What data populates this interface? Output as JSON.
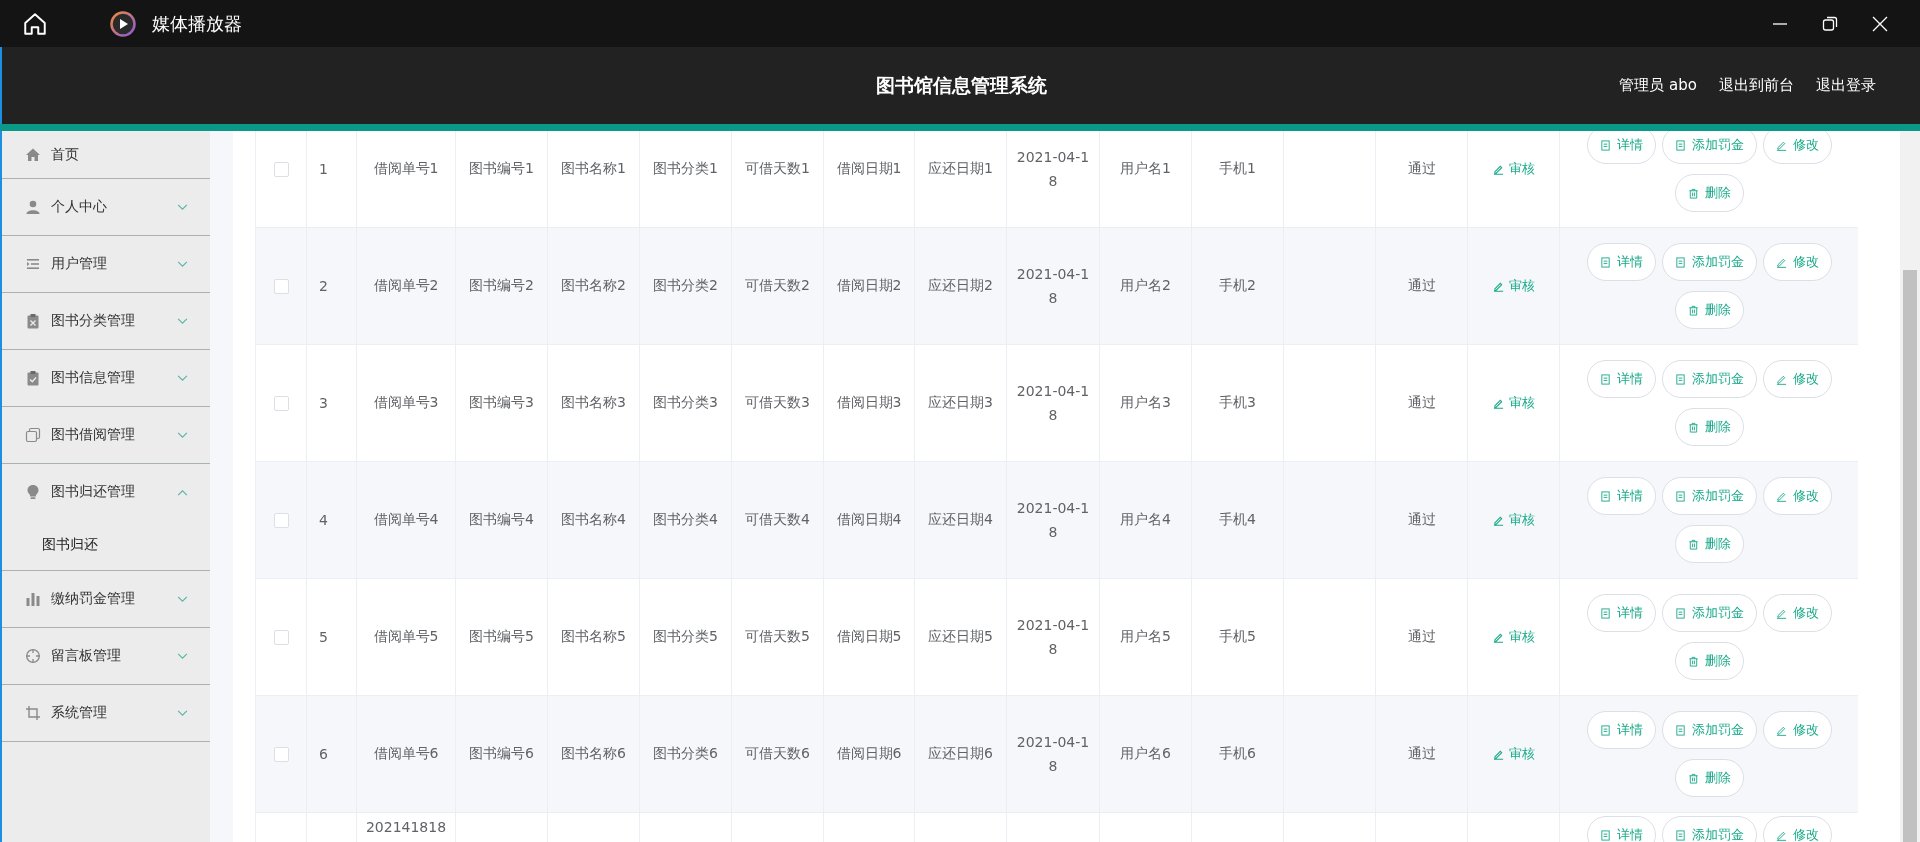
{
  "window": {
    "title": "媒体播放器"
  },
  "header": {
    "title": "图书馆信息管理系统",
    "user": "管理员 abo",
    "links": [
      "退出到前台",
      "退出登录"
    ]
  },
  "sidebar": {
    "items": [
      {
        "label": "首页",
        "kind": "link"
      },
      {
        "label": "个人中心",
        "kind": "menu",
        "expanded": false
      },
      {
        "label": "用户管理",
        "kind": "menu",
        "expanded": false
      },
      {
        "label": "图书分类管理",
        "kind": "menu",
        "expanded": false
      },
      {
        "label": "图书信息管理",
        "kind": "menu",
        "expanded": false
      },
      {
        "label": "图书借阅管理",
        "kind": "menu",
        "expanded": false
      },
      {
        "label": "图书归还管理",
        "kind": "menu",
        "expanded": true,
        "children": [
          {
            "label": "图书归还"
          }
        ]
      },
      {
        "label": "缴纳罚金管理",
        "kind": "menu",
        "expanded": false
      },
      {
        "label": "留言板管理",
        "kind": "menu",
        "expanded": false
      },
      {
        "label": "系统管理",
        "kind": "menu",
        "expanded": false
      }
    ]
  },
  "table": {
    "rows": [
      {
        "checked": false,
        "index": "1",
        "order_no": "借阅单号1",
        "book_no": "图书编号1",
        "book_name": "图书名称1",
        "category": "图书分类1",
        "loan_days": "可借天数1",
        "borrow_date": "借阅日期1",
        "due_date": "应还日期1",
        "return_date": "2021-04-18",
        "username": "用户名1",
        "phone": "手机1",
        "status": "通过",
        "review": "审核",
        "actions": [
          "详情",
          "添加罚金",
          "修改",
          "删除"
        ]
      },
      {
        "checked": false,
        "index": "2",
        "order_no": "借阅单号2",
        "book_no": "图书编号2",
        "book_name": "图书名称2",
        "category": "图书分类2",
        "loan_days": "可借天数2",
        "borrow_date": "借阅日期2",
        "due_date": "应还日期2",
        "return_date": "2021-04-18",
        "username": "用户名2",
        "phone": "手机2",
        "status": "通过",
        "review": "审核",
        "actions": [
          "详情",
          "添加罚金",
          "修改",
          "删除"
        ]
      },
      {
        "checked": false,
        "index": "3",
        "order_no": "借阅单号3",
        "book_no": "图书编号3",
        "book_name": "图书名称3",
        "category": "图书分类3",
        "loan_days": "可借天数3",
        "borrow_date": "借阅日期3",
        "due_date": "应还日期3",
        "return_date": "2021-04-18",
        "username": "用户名3",
        "phone": "手机3",
        "status": "通过",
        "review": "审核",
        "actions": [
          "详情",
          "添加罚金",
          "修改",
          "删除"
        ]
      },
      {
        "checked": false,
        "index": "4",
        "order_no": "借阅单号4",
        "book_no": "图书编号4",
        "book_name": "图书名称4",
        "category": "图书分类4",
        "loan_days": "可借天数4",
        "borrow_date": "借阅日期4",
        "due_date": "应还日期4",
        "return_date": "2021-04-18",
        "username": "用户名4",
        "phone": "手机4",
        "status": "通过",
        "review": "审核",
        "actions": [
          "详情",
          "添加罚金",
          "修改",
          "删除"
        ]
      },
      {
        "checked": false,
        "index": "5",
        "order_no": "借阅单号5",
        "book_no": "图书编号5",
        "book_name": "图书名称5",
        "category": "图书分类5",
        "loan_days": "可借天数5",
        "borrow_date": "借阅日期5",
        "due_date": "应还日期5",
        "return_date": "2021-04-18",
        "username": "用户名5",
        "phone": "手机5",
        "status": "通过",
        "review": "审核",
        "actions": [
          "详情",
          "添加罚金",
          "修改",
          "删除"
        ]
      },
      {
        "checked": false,
        "index": "6",
        "order_no": "借阅单号6",
        "book_no": "图书编号6",
        "book_name": "图书名称6",
        "category": "图书分类6",
        "loan_days": "可借天数6",
        "borrow_date": "借阅日期6",
        "due_date": "应还日期6",
        "return_date": "2021-04-18",
        "username": "用户名6",
        "phone": "手机6",
        "status": "通过",
        "review": "审核",
        "actions": [
          "详情",
          "添加罚金",
          "修改",
          "删除"
        ]
      },
      {
        "order_no": "202141818",
        "actions": [
          "详情",
          "添加罚金",
          "修改"
        ]
      }
    ]
  }
}
